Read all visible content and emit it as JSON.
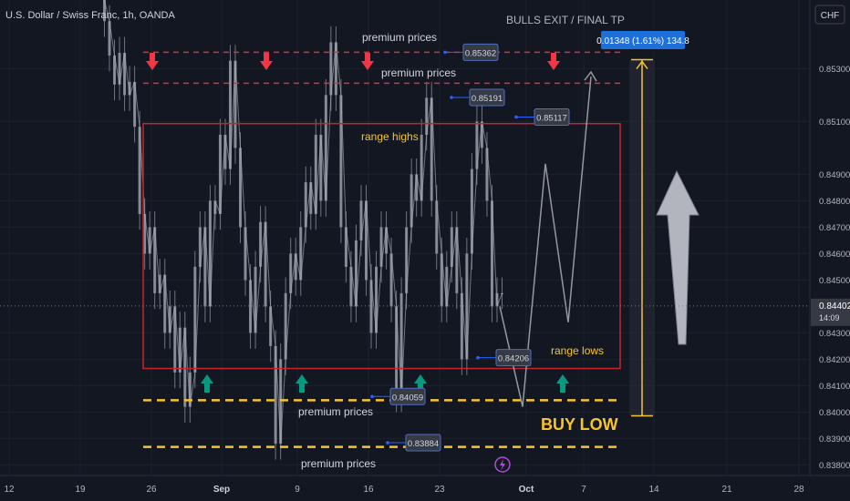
{
  "header": {
    "symbol_title": "U.S. Dollar / Swiss Franc, 1h, OANDA",
    "currency_button": "CHF"
  },
  "annotations": {
    "exit_label": "BULLS EXIT / FINAL TP",
    "measure_label": "0.01348 (1.61%) 134.8",
    "premium_top": "premium prices",
    "premium_second": "premium prices",
    "range_highs": "range highs",
    "range_lows": "range lows",
    "premium_lower_1": "premium prices",
    "premium_lower_2": "premium prices",
    "buy_low": "BUY LOW",
    "current_price": "0.84402",
    "countdown": "14:09"
  },
  "colors": {
    "background": "#131722",
    "candle": "#8f93a0",
    "red_line": "#d3343c",
    "yellow": "#f7c52b",
    "green_arrow": "#089981",
    "blue_badge": "#1e6fd9",
    "range_box": "#c2262e"
  },
  "chart_data": {
    "type": "line",
    "x_ticks": [
      "12",
      "19",
      "26",
      "Sep",
      "9",
      "16",
      "23",
      "Oct",
      "7",
      "14",
      "21",
      "28"
    ],
    "y_ticks": [
      0.853,
      0.851,
      0.849,
      0.848,
      0.847,
      0.846,
      0.845,
      0.843,
      0.842,
      0.841,
      0.84,
      0.839,
      0.838
    ],
    "ylim": [
      0.8376,
      0.8556
    ],
    "series": [
      {
        "values": [
          0.8556,
          0.8548,
          0.8535,
          0.8524,
          0.8536,
          0.852,
          0.8525,
          0.8508,
          0.8475,
          0.846,
          0.847,
          0.8445,
          0.8452,
          0.843,
          0.844,
          0.8415,
          0.8432,
          0.8402,
          0.8415,
          0.8455,
          0.847,
          0.844,
          0.848,
          0.8475,
          0.8505,
          0.8492,
          0.8533,
          0.85,
          0.847,
          0.845,
          0.843,
          0.8455,
          0.8472,
          0.844,
          0.8425,
          0.8388,
          0.842,
          0.8445,
          0.846,
          0.845,
          0.847,
          0.8487,
          0.8475,
          0.8505,
          0.848,
          0.852,
          0.854,
          0.852,
          0.847,
          0.8455,
          0.844,
          0.8465,
          0.848,
          0.845,
          0.843,
          0.8455,
          0.847,
          0.846,
          0.844,
          0.8406,
          0.8445,
          0.847,
          0.849,
          0.848,
          0.8505,
          0.8519,
          0.848,
          0.846,
          0.844,
          0.8455,
          0.847,
          0.8445,
          0.842,
          0.846,
          0.8492,
          0.851,
          0.85,
          0.848,
          0.844,
          0.8445
        ]
      }
    ],
    "projection_path": [
      [
        23,
        0.844
      ],
      [
        24,
        0.8402
      ],
      [
        25,
        0.8494
      ],
      [
        26,
        0.8434
      ],
      [
        27,
        0.8527
      ]
    ],
    "levels": [
      {
        "name": "premium-top",
        "value": 0.85362,
        "style": "red-dashed"
      },
      {
        "name": "premium-second",
        "value": 0.85245,
        "style": "red-dashed"
      },
      {
        "name": "premium-lower-1",
        "value": 0.84045,
        "style": "yellow-dashed"
      },
      {
        "name": "premium-lower-2",
        "value": 0.83868,
        "style": "yellow-dashed"
      }
    ],
    "range_box": {
      "high": 0.85092,
      "low": 0.84165
    },
    "price_tags": [
      {
        "value": "0.85362",
        "price": 0.85362
      },
      {
        "value": "0.85191",
        "price": 0.85191
      },
      {
        "value": "0.85117",
        "price": 0.85117
      },
      {
        "value": "0.84206",
        "price": 0.84206
      },
      {
        "value": "0.84059",
        "price": 0.84059
      },
      {
        "value": "0.83884",
        "price": 0.83884
      }
    ],
    "measure": {
      "from": 0.83986,
      "to": 0.85334
    },
    "current_price": 0.84402,
    "down_arrows": 4,
    "up_arrows": 4
  }
}
